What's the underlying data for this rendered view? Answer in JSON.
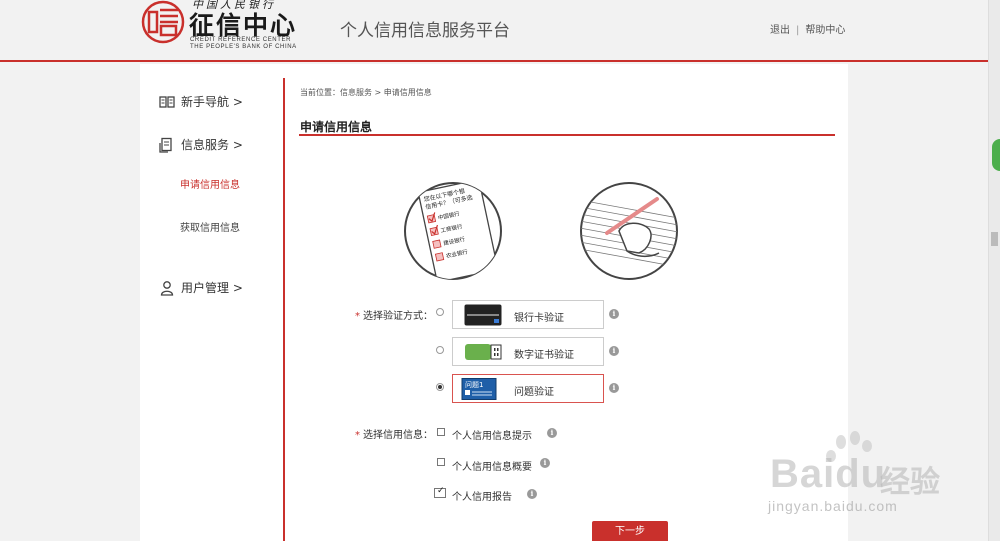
{
  "header": {
    "logo_top": "中国人民银行",
    "logo_main": "征信中心",
    "logo_en_line1": "CREDIT REFERENCE CENTER",
    "logo_en_line2": "THE PEOPLE'S BANK OF CHINA",
    "platform_title": "个人信用信息服务平台",
    "logout": "退出",
    "separator": "|",
    "help": "帮助中心"
  },
  "sidebar": {
    "items": [
      {
        "label": "新手导航 >",
        "icon": "book-icon"
      },
      {
        "label": "信息服务 >",
        "icon": "document-icon"
      },
      {
        "label": "用户管理 >",
        "icon": "user-icon"
      }
    ],
    "sub_items": [
      {
        "label": "申请信用信息",
        "active": true
      },
      {
        "label": "获取信用信息",
        "active": false
      }
    ]
  },
  "main": {
    "breadcrumb": "当前位置：信息服务 > 申请信用信息",
    "section_title": "申请信用信息",
    "illustration": {
      "form_lines": [
        "您在以下哪个银",
        "信用卡？（可多选"
      ],
      "banks": [
        "中国银行",
        "工商银行",
        "建设银行",
        "农业银行"
      ]
    },
    "verify": {
      "label": "选择验证方式：",
      "required_mark": "*",
      "options": [
        {
          "label": "银行卡验证",
          "icon": "bank-card-icon",
          "selected": false
        },
        {
          "label": "数字证书验证",
          "icon": "usb-key-icon",
          "selected": false
        },
        {
          "label": "问题验证",
          "icon": "question-card-icon",
          "icon_text": "问题1",
          "selected": true
        }
      ]
    },
    "credit_info": {
      "label": "选择信用信息：",
      "required_mark": "*",
      "options": [
        {
          "label": "个人信用信息提示",
          "checked": false
        },
        {
          "label": "个人信用信息概要",
          "checked": false
        },
        {
          "label": "个人信用报告",
          "checked": true
        }
      ]
    },
    "next_button": "下一步"
  },
  "watermark": {
    "brand": "Bai",
    "brand_tail": "du",
    "cn": "经验",
    "url": "jingyan.baidu.com"
  },
  "colors": {
    "accent": "#c9302c",
    "background": "#f2f2f2"
  }
}
